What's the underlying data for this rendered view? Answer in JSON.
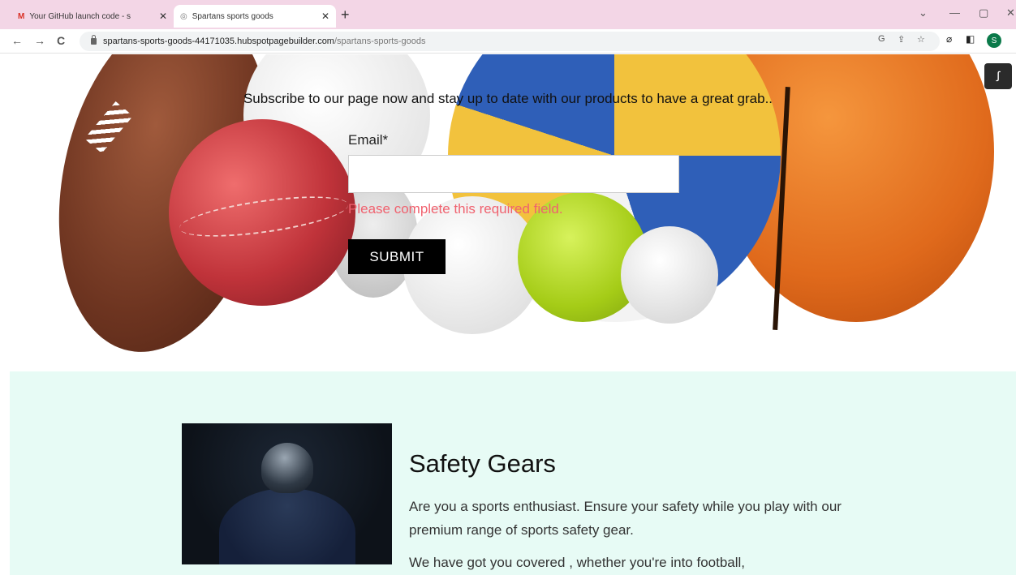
{
  "browser": {
    "tabs": [
      {
        "title": "Your GitHub launch code - s",
        "active": false
      },
      {
        "title": "Spartans sports goods",
        "active": true
      }
    ],
    "url_host": "spartans-sports-goods-44171035.hubspotpagebuilder.com",
    "url_path": "/spartans-sports-goods",
    "profile_initial": "S",
    "new_tab": "+",
    "back": "←",
    "forward": "→",
    "reload": "C"
  },
  "hero": {
    "subscribe_text": "Subscribe to our page now and stay up to date with our products to have a great grab..",
    "email_label": "Email*",
    "error_text": "Please complete this required field.",
    "submit_label": "SUBMIT"
  },
  "safety": {
    "heading": "Safety Gears",
    "paragraph1": "Are you a sports enthusiast. Ensure your safety while you play with our premium range of sports safety gear.",
    "paragraph2": "We have got you covered , whether you're into football,"
  }
}
